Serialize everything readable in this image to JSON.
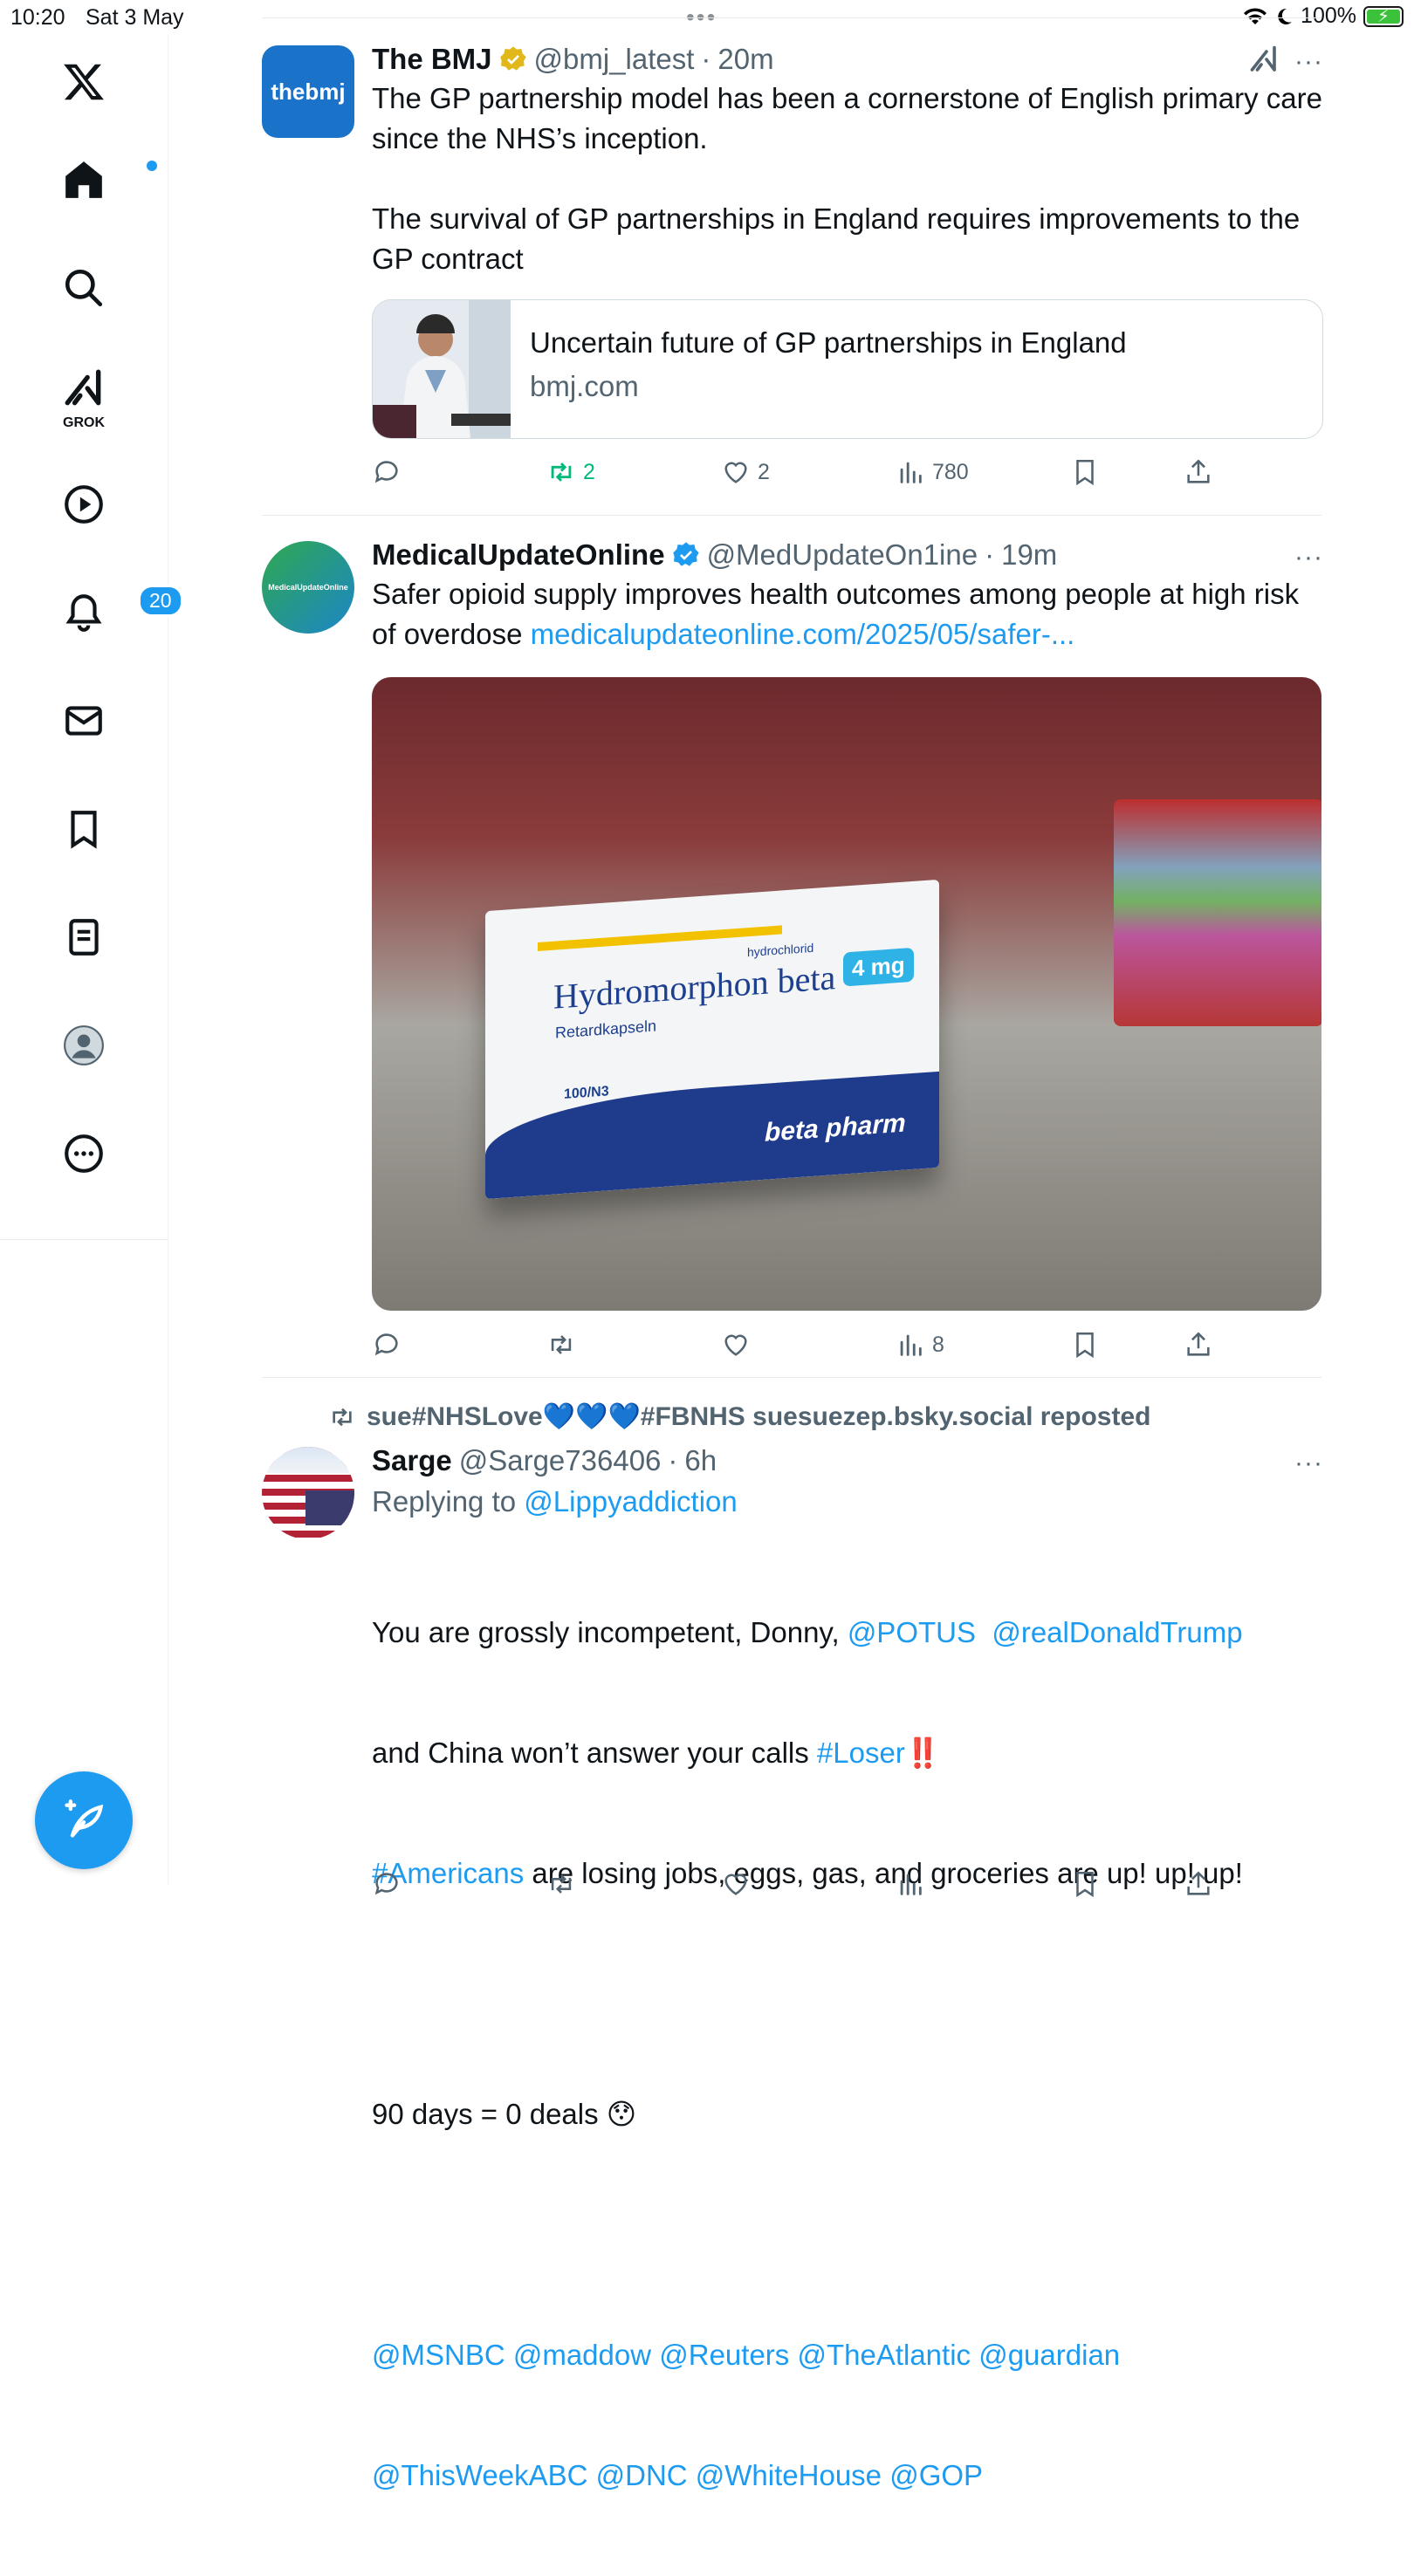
{
  "status_bar": {
    "time": "10:20",
    "date": "Sat 3 May",
    "battery": "100%"
  },
  "sidebar": {
    "items": [
      {
        "name": "home",
        "icon": "home-icon"
      },
      {
        "name": "search",
        "icon": "search-icon"
      },
      {
        "name": "grok",
        "icon": "grok-icon",
        "label": "GROK"
      },
      {
        "name": "video",
        "icon": "play-icon"
      },
      {
        "name": "notifications",
        "icon": "bell-icon",
        "badge": "20"
      },
      {
        "name": "messages",
        "icon": "mail-icon"
      },
      {
        "name": "bookmarks",
        "icon": "bookmark-icon"
      },
      {
        "name": "lists",
        "icon": "list-icon"
      },
      {
        "name": "profile",
        "icon": "avatar-icon"
      },
      {
        "name": "more",
        "icon": "more-icon"
      }
    ],
    "compose_icon": "compose-icon"
  },
  "tweets": [
    {
      "display_name": "The BMJ",
      "handle": "@bmj_latest",
      "time": "20m",
      "avatar_text": "thebmj",
      "text": "The GP partnership model has been a cornerstone of English primary care since the NHS’s inception.\n\nThe survival of GP partnerships in England requires improvements to the GP contract",
      "card": {
        "title": "Uncertain future of GP partnerships in England",
        "domain": "bmj.com"
      },
      "stats": {
        "replies": "",
        "reposts": "2",
        "likes": "2",
        "views": "780"
      }
    },
    {
      "display_name": "MedicalUpdateOnline",
      "handle": "@MedUpdateOn1ine",
      "time": "19m",
      "avatar_text": "MedicalUpdateOnline",
      "text": "Safer opioid supply improves health outcomes among people at high risk of overdose ",
      "link": "medicalupdateonline.com/2025/05/safer-...",
      "media": {
        "brand": "Hydromorphon beta",
        "sub": "Retardkapseln",
        "small": "hydrochlorid",
        "dose": "4 mg",
        "pack": "100/N3",
        "logo": "beta pharm"
      },
      "stats": {
        "views": "8"
      }
    },
    {
      "repost_by": "sue#NHSLove💙💙💙#FBNHS suesuezep.bsky.social reposted",
      "display_name": "Sarge",
      "handle": "@Sarge736406",
      "time": "6h",
      "replying_prefix": "Replying to ",
      "replying_to": "@Lippyaddiction",
      "line1_a": "You are grossly incompetent, Donny, ",
      "line1_m1": "@POTUS",
      "line1_m2": "@realDonaldTrump",
      "line2_a": "and China won’t answer your calls ",
      "line2_tag": "#Loser",
      "line2_emoji": "‼️",
      "line3_tag": "#Americans",
      "line3_rest": " are losing jobs, eggs, gas, and groceries are up! up! up!",
      "line4": "90 days = 0 deals 😯",
      "mentions1": "@MSNBC @maddow @Reuters @TheAtlantic @guardian",
      "mentions2": "@ThisWeekABC @DNC @WhiteHouse @GOP"
    }
  ]
}
